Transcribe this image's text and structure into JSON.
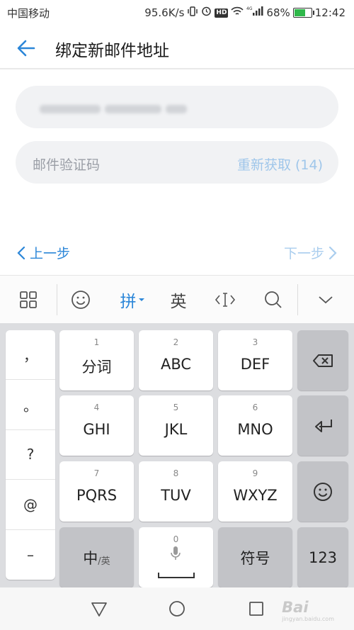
{
  "status_bar": {
    "carrier": "中国移动",
    "speed": "95.6K/s",
    "network": "4G",
    "hd": "HD",
    "battery_pct": "68%",
    "battery_level": 0.68,
    "time": "12:42"
  },
  "header": {
    "title": "绑定新邮件地址"
  },
  "form": {
    "code_placeholder": "邮件验证码",
    "resend_label": "重新获取 (14)"
  },
  "nav": {
    "prev_label": "上一步",
    "next_label": "下一步"
  },
  "ime_toolbar": {
    "pinyin_label": "拼",
    "english_label": "英",
    "accent_color": "#2b86d8"
  },
  "keyboard": {
    "left_symbols": [
      "，",
      "。",
      "?",
      "@",
      "–"
    ],
    "keys": [
      {
        "num": "1",
        "label": "分词"
      },
      {
        "num": "2",
        "label": "ABC"
      },
      {
        "num": "3",
        "label": "DEF"
      },
      {
        "num": "4",
        "label": "GHI"
      },
      {
        "num": "5",
        "label": "JKL"
      },
      {
        "num": "6",
        "label": "MNO"
      },
      {
        "num": "7",
        "label": "PQRS"
      },
      {
        "num": "8",
        "label": "TUV"
      },
      {
        "num": "9",
        "label": "WXYZ"
      }
    ],
    "space_num": "0",
    "lang_switch_main": "中",
    "lang_switch_sub": "/英",
    "symbols_label": "符号",
    "numbers_label": "123"
  },
  "watermark": {
    "text": "Bai",
    "sub": "jingyan.baidu.com"
  }
}
